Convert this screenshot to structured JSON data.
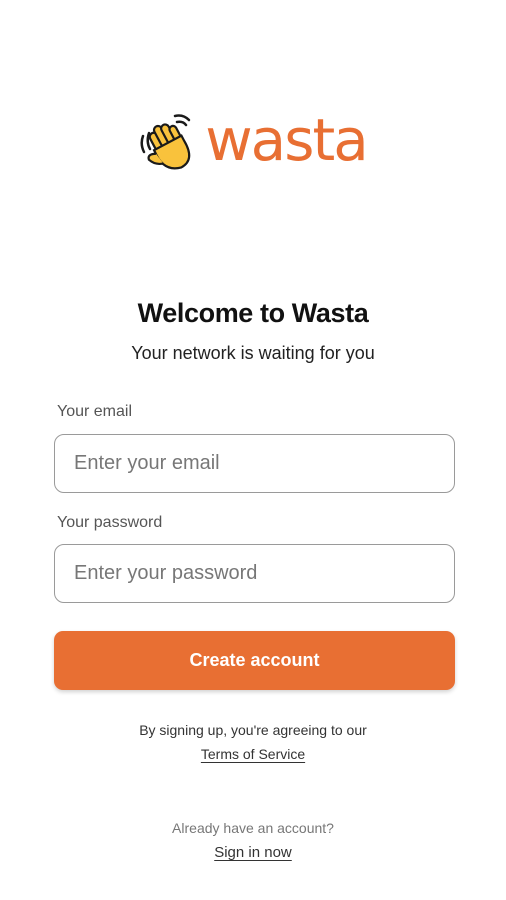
{
  "brand": {
    "name": "wasta",
    "accent_color": "#E86F33",
    "icon": "waving-hand-icon"
  },
  "welcome": {
    "title": "Welcome to Wasta",
    "subtitle": "Your network is waiting for you"
  },
  "form": {
    "email": {
      "label": "Your email",
      "placeholder": "Enter your email",
      "value": ""
    },
    "password": {
      "label": "Your password",
      "placeholder": "Enter your password",
      "value": ""
    },
    "submit_label": "Create account",
    "submit_color": "#E86F33"
  },
  "legal": {
    "text": "By signing up, you're agreeing to our",
    "link_label": "Terms of Service"
  },
  "signin": {
    "prompt": "Already have an account?",
    "link_label": "Sign in now"
  }
}
